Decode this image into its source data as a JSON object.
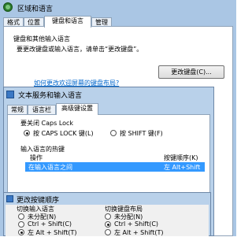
{
  "region_window": {
    "title": "区域和语言",
    "tabs": [
      "格式",
      "位置",
      "键盘和语言",
      "管理"
    ],
    "active_tab": "键盘和语言",
    "group_title": "键盘和其他输入语言",
    "description": "要更改键盘或输入语言，请单击“更改键盘”。",
    "change_keyboard_button": "更改键盘(C)...",
    "link_text": "如何更改欢迎屏幕的键盘布局?"
  },
  "text_services_window": {
    "title": "文本服务和输入语言",
    "tabs": [
      "常规",
      "语言栏",
      "高级键设置"
    ],
    "active_tab": "高级键设置",
    "caps_lock_label": "要关闭 Caps Lock",
    "caps_lock_options": [
      "按 CAPS LOCK 键(L)",
      "按 SHIFT 键(F)"
    ],
    "hotkeys_label": "输入语言的热键",
    "column_action": "操作",
    "column_keys": "按键顺序(K)",
    "row_action": "在输入语言之间",
    "row_keys": "左 Alt+Shift"
  },
  "change_sequence_window": {
    "title": "更改按键顺序",
    "left_group": "切换输入语言",
    "left_options": [
      "未分配(N)",
      "Ctrl + Shift(C)",
      "左 Alt + Shift(T)"
    ],
    "right_group": "切换键盘布局",
    "right_options": [
      "未分配(N)",
      "Ctrl + Shift(C)",
      "左 Alt + Shift(T)"
    ],
    "colors": {
      "selection": "#3399ff",
      "link": "#0066cc"
    }
  }
}
